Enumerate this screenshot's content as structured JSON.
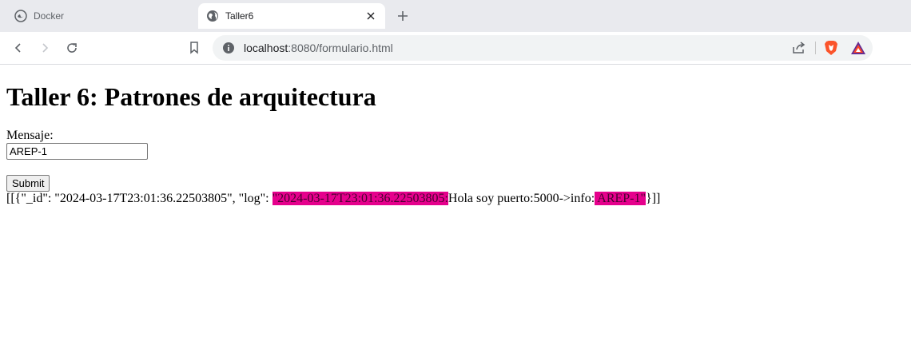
{
  "tabs": [
    {
      "title": "Docker",
      "active": false
    },
    {
      "title": "Taller6",
      "active": true
    }
  ],
  "toolbar": {
    "url_host": "localhost",
    "url_path": ":8080/formulario.html"
  },
  "page": {
    "heading": "Taller 6: Patrones de arquitectura",
    "label": "Mensaje:",
    "input_value": "AREP-1",
    "submit_label": "Submit",
    "response": {
      "prefix": "[[{\"_id\": \"2024-03-17T23:01:36.22503805\", \"log\": ",
      "highlight1": "\"2024-03-17T23:01:36.22503805:",
      "middle": "Hola soy puerto:5000->info:",
      "highlight2": " AREP-1\"",
      "suffix": "}]]"
    }
  },
  "colors": {
    "highlight": "#e5008c",
    "tabbar": "#e9eaee",
    "omnibox": "#f1f3f4"
  }
}
